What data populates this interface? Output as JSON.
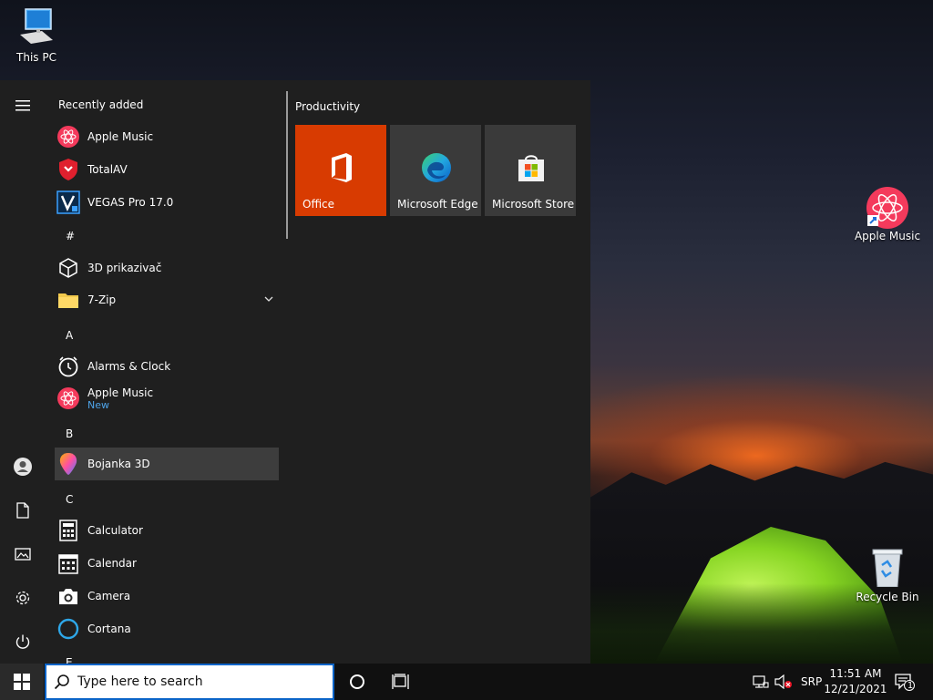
{
  "desktop": {
    "icons": [
      {
        "label": "This PC"
      },
      {
        "label": "Apple Music"
      },
      {
        "label": "Recycle Bin"
      }
    ]
  },
  "start_menu": {
    "recently_added_label": "Recently added",
    "recent_apps": [
      {
        "name": "Apple Music",
        "icon": "apple-music-icon"
      },
      {
        "name": "TotalAV",
        "icon": "totalav-shield-icon"
      },
      {
        "name": "VEGAS Pro 17.0",
        "icon": "vegas-icon"
      }
    ],
    "sections": [
      {
        "letter": "#",
        "apps": [
          {
            "name": "3D prikazivač",
            "icon": "cube-icon"
          },
          {
            "name": "7-Zip",
            "icon": "folder-icon",
            "expandable": true
          }
        ]
      },
      {
        "letter": "A",
        "apps": [
          {
            "name": "Alarms & Clock",
            "icon": "clock-icon"
          },
          {
            "name": "Apple Music",
            "sub": "New",
            "icon": "apple-music-icon"
          }
        ]
      },
      {
        "letter": "B",
        "apps": [
          {
            "name": "Bojanka 3D",
            "icon": "paint3d-icon"
          }
        ]
      },
      {
        "letter": "C",
        "apps": [
          {
            "name": "Calculator",
            "icon": "calculator-icon"
          },
          {
            "name": "Calendar",
            "icon": "calendar-icon"
          },
          {
            "name": "Camera",
            "icon": "camera-icon"
          },
          {
            "name": "Cortana",
            "icon": "cortana-icon"
          }
        ]
      },
      {
        "letter": "E",
        "apps": []
      }
    ],
    "tiles_group": "Productivity",
    "tiles": [
      {
        "label": "Office",
        "color": "#d83b01"
      },
      {
        "label": "Microsoft Edge",
        "color": "#3a3a3a"
      },
      {
        "label": "Microsoft Store",
        "color": "#3a3a3a"
      }
    ]
  },
  "taskbar": {
    "search_placeholder": "Type here to search",
    "language": "SRP",
    "time": "11:51 AM",
    "date": "12/21/2021",
    "notification_count": "1"
  },
  "colors": {
    "accent": "#0a64c8",
    "office": "#d83b01",
    "menu_bg": "#1f1f1f",
    "list_bg": "#2b2b2b",
    "new_badge": "#4ea3e8"
  }
}
